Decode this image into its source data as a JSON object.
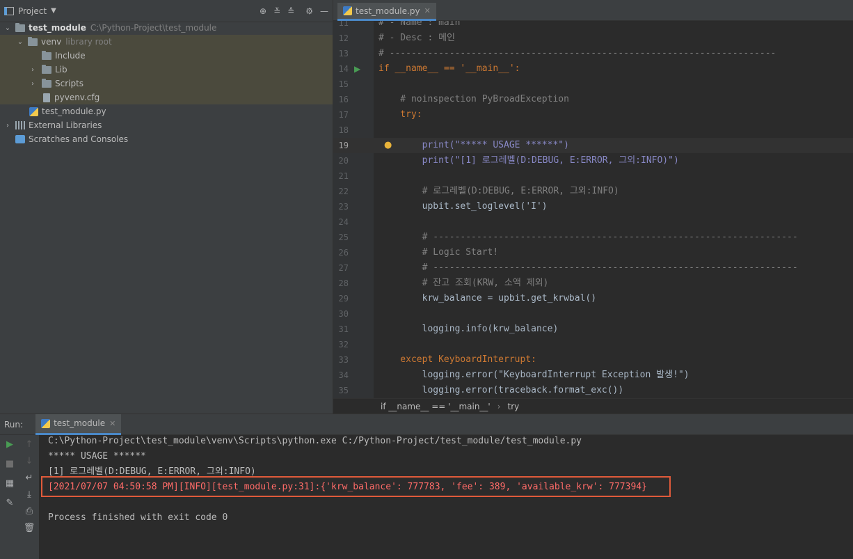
{
  "project": {
    "title": "Project",
    "tree": [
      {
        "label": "test_module",
        "path": "C:\\Python-Project\\test_module"
      },
      {
        "label": "venv",
        "note": "library root"
      },
      {
        "label": "Include"
      },
      {
        "label": "Lib"
      },
      {
        "label": "Scripts"
      },
      {
        "label": "pyvenv.cfg"
      },
      {
        "label": "test_module.py"
      },
      {
        "label": "External Libraries"
      },
      {
        "label": "Scratches and Consoles"
      }
    ]
  },
  "editor": {
    "tab": "test_module.py",
    "lines": [
      {
        "n": "11",
        "text": "# - Name : main"
      },
      {
        "n": "12",
        "text": "# - Desc : 메인"
      },
      {
        "n": "13",
        "text": "# -----------------------------------------------------------------------"
      },
      {
        "n": "14",
        "text": "if __name__ == '__main__':"
      },
      {
        "n": "15",
        "text": ""
      },
      {
        "n": "16",
        "text": "    # noinspection PyBroadException"
      },
      {
        "n": "17",
        "text": "    try:"
      },
      {
        "n": "18",
        "text": ""
      },
      {
        "n": "19",
        "text": "        print(\"***** USAGE ******\")"
      },
      {
        "n": "20",
        "text": "        print(\"[1] 로그레벨(D:DEBUG, E:ERROR, 그외:INFO)\")"
      },
      {
        "n": "21",
        "text": ""
      },
      {
        "n": "22",
        "text": "        # 로그레벨(D:DEBUG, E:ERROR, 그외:INFO)"
      },
      {
        "n": "23",
        "text": "        upbit.set_loglevel('I')"
      },
      {
        "n": "24",
        "text": ""
      },
      {
        "n": "25",
        "text": "        # -------------------------------------------------------------------"
      },
      {
        "n": "26",
        "text": "        # Logic Start!"
      },
      {
        "n": "27",
        "text": "        # -------------------------------------------------------------------"
      },
      {
        "n": "28",
        "text": "        # 잔고 조회(KRW, 소액 제외)"
      },
      {
        "n": "29",
        "text": "        krw_balance = upbit.get_krwbal()"
      },
      {
        "n": "30",
        "text": ""
      },
      {
        "n": "31",
        "text": "        logging.info(krw_balance)"
      },
      {
        "n": "32",
        "text": ""
      },
      {
        "n": "33",
        "text": "    except KeyboardInterrupt:"
      },
      {
        "n": "34",
        "text": "        logging.error(\"KeyboardInterrupt Exception 발생!\")"
      },
      {
        "n": "35",
        "text": "        logging.error(traceback.format_exc())"
      }
    ],
    "breadcrumb": [
      "if __name__ == '__main__'",
      "try"
    ]
  },
  "run": {
    "label": "Run:",
    "tab": "test_module",
    "output": [
      "C:\\Python-Project\\test_module\\venv\\Scripts\\python.exe C:/Python-Project/test_module/test_module.py",
      "***** USAGE ******",
      "[1] 로그레벨(D:DEBUG, E:ERROR, 그외:INFO)",
      "[2021/07/07 04:50:58 PM][INFO][test_module.py:31]:{'krw_balance': 777783, 'fee': 389, 'available_krw': 777394}",
      "",
      "Process finished with exit code 0"
    ]
  }
}
